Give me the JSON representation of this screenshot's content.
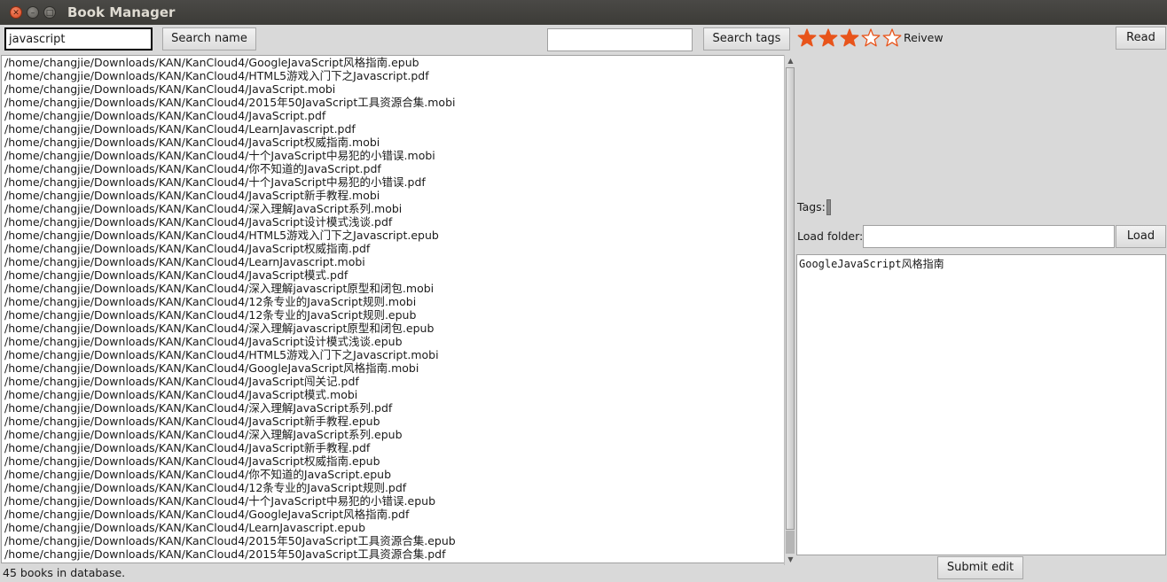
{
  "window": {
    "title": "Book Manager"
  },
  "toolbar": {
    "search_name_value": "javascript",
    "search_name_button": "Search name",
    "search_tags_value": "",
    "search_tags_button": "Search tags"
  },
  "books": [
    "/home/changjie/Downloads/KAN/KanCloud4/GoogleJavaScript风格指南.epub",
    "/home/changjie/Downloads/KAN/KanCloud4/HTML5游戏入门下之Javascript.pdf",
    "/home/changjie/Downloads/KAN/KanCloud4/JavaScript.mobi",
    "/home/changjie/Downloads/KAN/KanCloud4/2015年50JavaScript工具资源合集.mobi",
    "/home/changjie/Downloads/KAN/KanCloud4/JavaScript.pdf",
    "/home/changjie/Downloads/KAN/KanCloud4/LearnJavascript.pdf",
    "/home/changjie/Downloads/KAN/KanCloud4/JavaScript权威指南.mobi",
    "/home/changjie/Downloads/KAN/KanCloud4/十个JavaScript中易犯的小错误.mobi",
    "/home/changjie/Downloads/KAN/KanCloud4/你不知道的JavaScript.pdf",
    "/home/changjie/Downloads/KAN/KanCloud4/十个JavaScript中易犯的小错误.pdf",
    "/home/changjie/Downloads/KAN/KanCloud4/JavaScript新手教程.mobi",
    "/home/changjie/Downloads/KAN/KanCloud4/深入理解JavaScript系列.mobi",
    "/home/changjie/Downloads/KAN/KanCloud4/JavaScript设计模式浅谈.pdf",
    "/home/changjie/Downloads/KAN/KanCloud4/HTML5游戏入门下之Javascript.epub",
    "/home/changjie/Downloads/KAN/KanCloud4/JavaScript权威指南.pdf",
    "/home/changjie/Downloads/KAN/KanCloud4/LearnJavascript.mobi",
    "/home/changjie/Downloads/KAN/KanCloud4/JavaScript模式.pdf",
    "/home/changjie/Downloads/KAN/KanCloud4/深入理解javascript原型和闭包.mobi",
    "/home/changjie/Downloads/KAN/KanCloud4/12条专业的JavaScript规则.mobi",
    "/home/changjie/Downloads/KAN/KanCloud4/12条专业的JavaScript规则.epub",
    "/home/changjie/Downloads/KAN/KanCloud4/深入理解javascript原型和闭包.epub",
    "/home/changjie/Downloads/KAN/KanCloud4/JavaScript设计模式浅谈.epub",
    "/home/changjie/Downloads/KAN/KanCloud4/HTML5游戏入门下之Javascript.mobi",
    "/home/changjie/Downloads/KAN/KanCloud4/GoogleJavaScript风格指南.mobi",
    "/home/changjie/Downloads/KAN/KanCloud4/JavaScript闯关记.pdf",
    "/home/changjie/Downloads/KAN/KanCloud4/JavaScript模式.mobi",
    "/home/changjie/Downloads/KAN/KanCloud4/深入理解JavaScript系列.pdf",
    "/home/changjie/Downloads/KAN/KanCloud4/JavaScript新手教程.epub",
    "/home/changjie/Downloads/KAN/KanCloud4/深入理解JavaScript系列.epub",
    "/home/changjie/Downloads/KAN/KanCloud4/JavaScript新手教程.pdf",
    "/home/changjie/Downloads/KAN/KanCloud4/JavaScript权威指南.epub",
    "/home/changjie/Downloads/KAN/KanCloud4/你不知道的JavaScript.epub",
    "/home/changjie/Downloads/KAN/KanCloud4/12条专业的JavaScript规则.pdf",
    "/home/changjie/Downloads/KAN/KanCloud4/十个JavaScript中易犯的小错误.epub",
    "/home/changjie/Downloads/KAN/KanCloud4/GoogleJavaScript风格指南.pdf",
    "/home/changjie/Downloads/KAN/KanCloud4/LearnJavascript.epub",
    "/home/changjie/Downloads/KAN/KanCloud4/2015年50JavaScript工具资源合集.epub",
    "/home/changjie/Downloads/KAN/KanCloud4/2015年50JavaScript工具资源合集.pdf"
  ],
  "status": "45 books in database.",
  "detail": {
    "rating": 3,
    "rating_max": 5,
    "star_color": "#e8541b",
    "review_label": "Reivew",
    "read_button": "Read",
    "tags_label": "Tags:",
    "load_folder_label": "Load folder:",
    "load_folder_value": "",
    "load_button": "Load",
    "edit_text": "GoogleJavaScript风格指南",
    "submit_button": "Submit edit"
  }
}
